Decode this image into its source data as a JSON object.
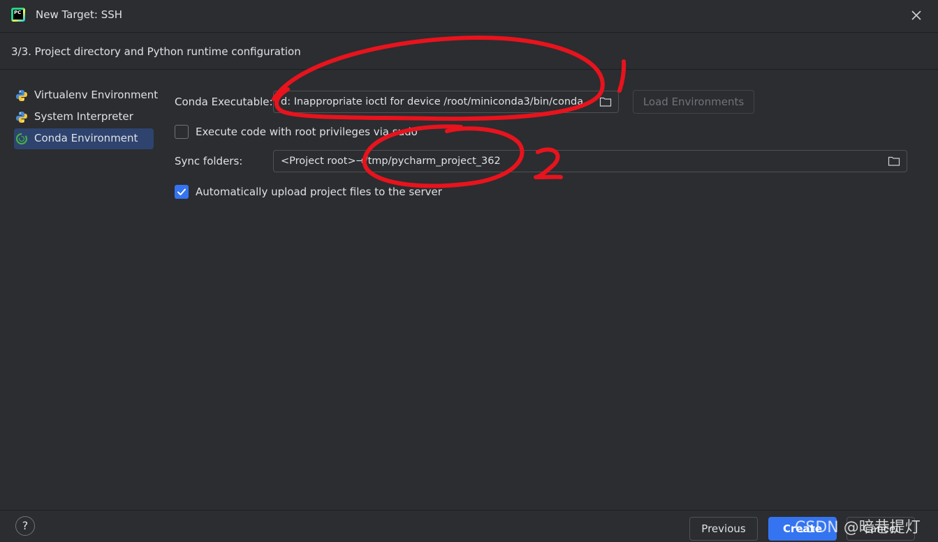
{
  "window": {
    "title": "New Target: SSH",
    "logo_text": "PC"
  },
  "step_title": "3/3. Project directory and Python runtime configuration",
  "sidebar": {
    "items": [
      {
        "label": "Virtualenv Environment",
        "icon": "python-icon",
        "selected": false
      },
      {
        "label": "System Interpreter",
        "icon": "python-icon",
        "selected": false
      },
      {
        "label": "Conda Environment",
        "icon": "conda-icon",
        "selected": true
      }
    ]
  },
  "form": {
    "conda_label": "Conda Executable:",
    "conda_value": "d: Inappropriate ioctl for device /root/miniconda3/bin/conda",
    "load_environments_label": "Load Environments",
    "root_privileges_label": "Execute code with root privileges via sudo",
    "root_privileges_checked": false,
    "sync_label": "Sync folders:",
    "sync_value": "<Project root>→/tmp/pycharm_project_362",
    "auto_upload_label": "Automatically upload project files to the server",
    "auto_upload_checked": true
  },
  "footer": {
    "help_label": "?",
    "previous_label": "Previous",
    "create_label": "Create",
    "cancel_label": "Cancel"
  },
  "watermark": "CSDN @暗巷提灯",
  "annotations": {
    "mark_1": "1",
    "mark_2": "2",
    "color": "#e8131d"
  },
  "colors": {
    "background": "#2b2d30",
    "accent": "#3574f0",
    "selection": "#2e436e",
    "text": "#dfe1e5"
  }
}
